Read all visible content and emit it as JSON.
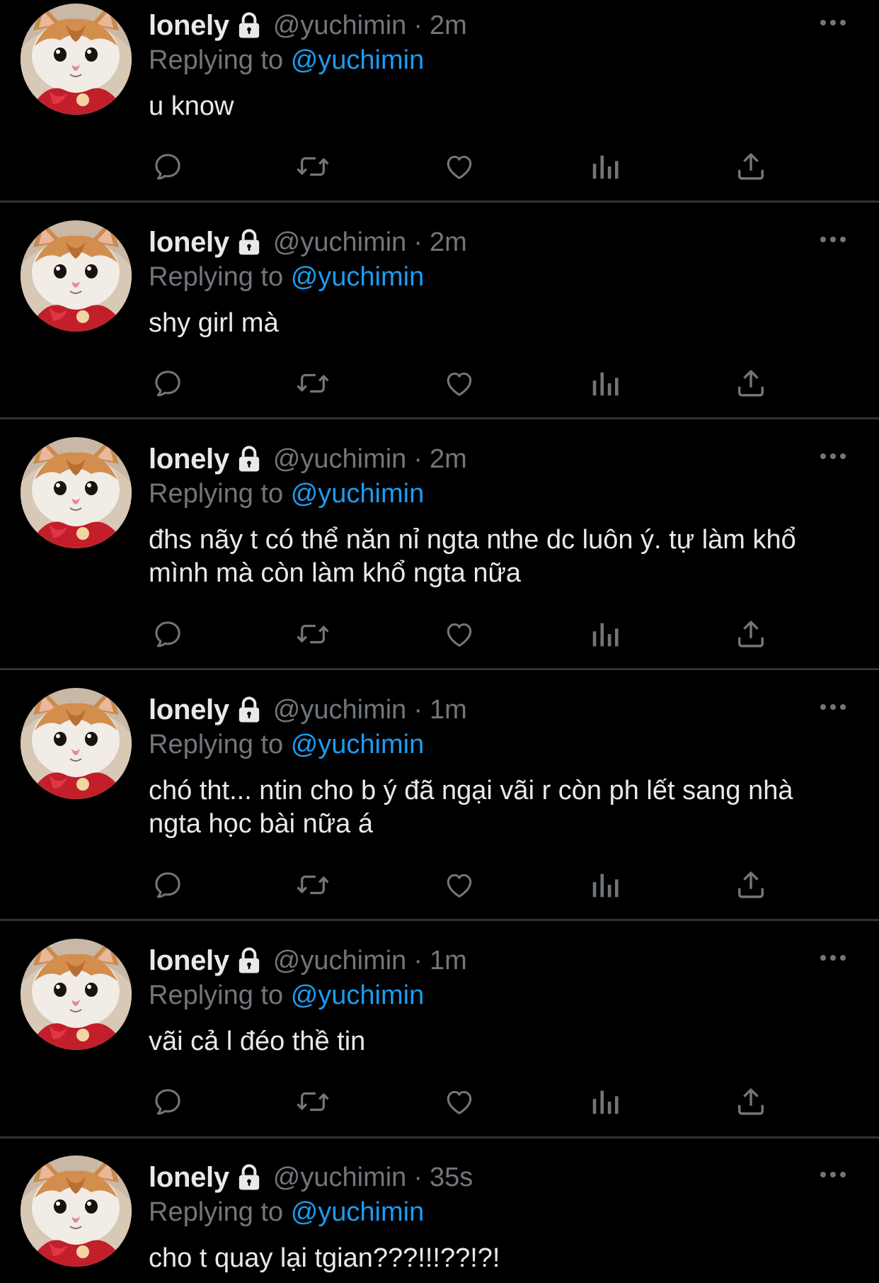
{
  "author": {
    "display_name": "lonely",
    "handle": "@yuchimin",
    "avatar_icon": "cat-avatar",
    "protected_icon": "lock-icon"
  },
  "reply_prefix": "Replying to",
  "reply_target": "@yuchimin",
  "separator": "·",
  "actions": [
    "reply-icon",
    "retweet-icon",
    "like-icon",
    "views-icon",
    "share-icon"
  ],
  "colors": {
    "background": "#000000",
    "text": "#e7e9ea",
    "muted": "#71767b",
    "accent": "#1d9bf0",
    "divider": "#2f3336"
  },
  "tweets": [
    {
      "time": "2m",
      "text": "u know"
    },
    {
      "time": "2m",
      "text": "shy girl mà"
    },
    {
      "time": "2m",
      "text": "đhs nãy t có thể năn nỉ ngta nthe dc luôn ý. tự làm khổ mình mà còn làm khổ ngta nữa"
    },
    {
      "time": "1m",
      "text": "chó tht... ntin cho b ý đã ngại vãi r còn ph lết sang nhà ngta học bài nữa á"
    },
    {
      "time": "1m",
      "text": "vãi cả l đéo thề tin"
    },
    {
      "time": "35s",
      "text": "cho t quay lại tgian???!!!??!?!"
    }
  ]
}
